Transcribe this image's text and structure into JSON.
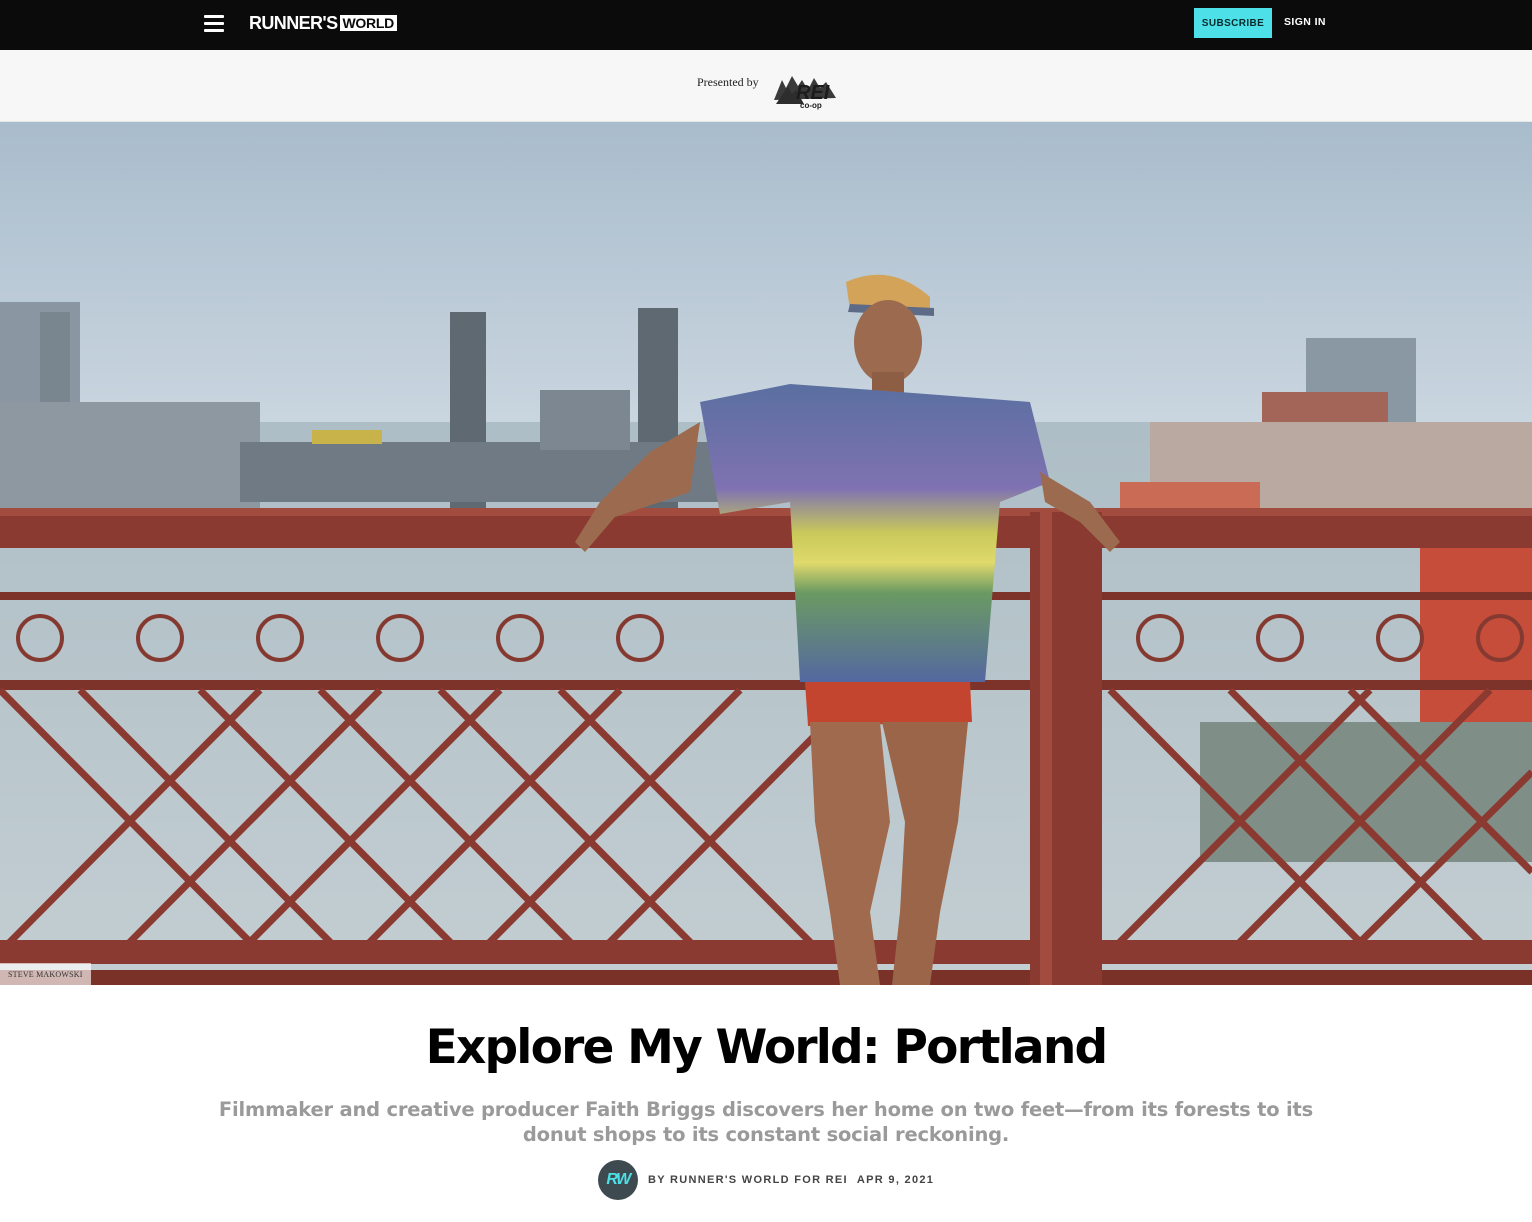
{
  "nav": {
    "logo_main": "RUNNER'S",
    "logo_badge": "WORLD",
    "subscribe_label": "SUBSCRIBE",
    "signin_label": "SIGN IN"
  },
  "sponsor": {
    "presented_by": "Presented by",
    "logo_text": "REI",
    "logo_sub": "co-op"
  },
  "hero": {
    "photo_credit": "STEVE MAKOWSKI"
  },
  "article": {
    "title": "Explore My World: Portland",
    "dek": "Filmmaker and creative producer Faith Briggs discovers her home on two feet—from its forests to its donut shops to its constant social reckoning.",
    "avatar_initials": "RW",
    "byline": "BY RUNNER'S WORLD FOR REI",
    "date": "APR 9, 2021"
  },
  "colors": {
    "nav_bg": "#0b0b0b",
    "subscribe_bg": "#4de0e8",
    "railing": "#8a3a30",
    "dek": "#9a9a9a"
  }
}
